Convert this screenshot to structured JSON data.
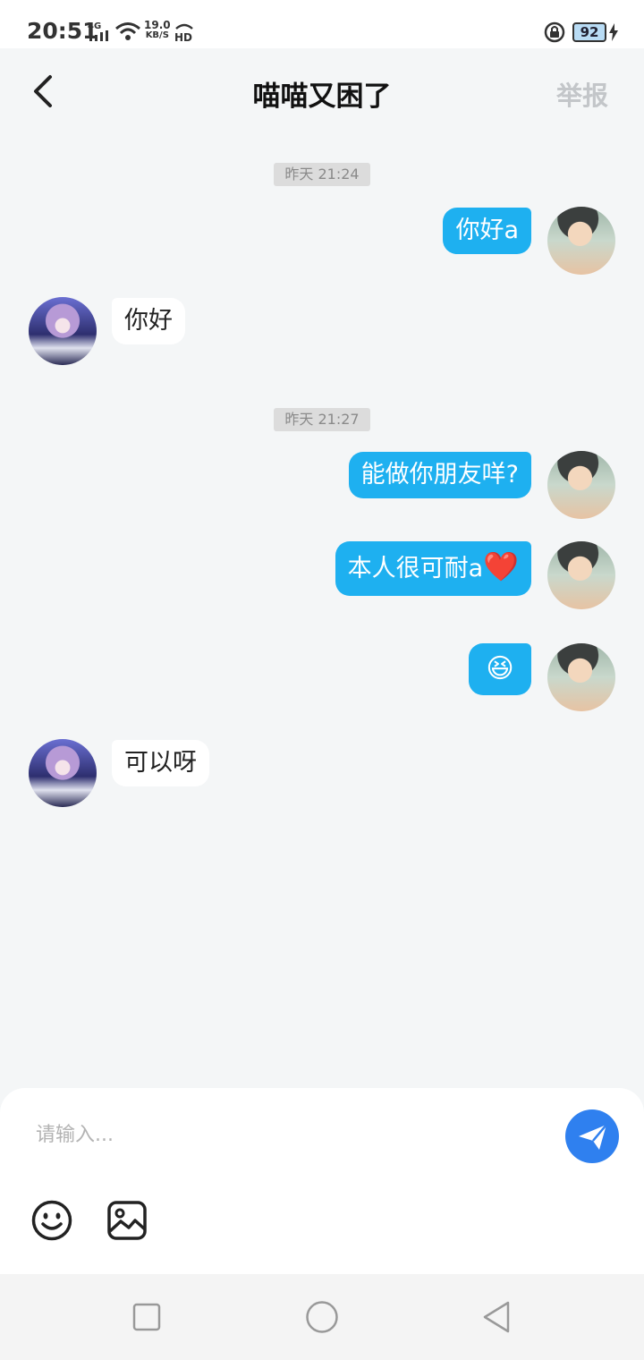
{
  "status_bar": {
    "time": "20:51",
    "network": "4G",
    "speed_value": "19.0",
    "speed_unit": "KB/S",
    "hd": "HD",
    "battery": "92"
  },
  "header": {
    "title": "喵喵又困了",
    "report": "举报"
  },
  "messages": [
    {
      "type": "timestamp",
      "text": "昨天 21:24"
    },
    {
      "type": "out",
      "text": "你好a"
    },
    {
      "type": "in",
      "text": "你好"
    },
    {
      "type": "timestamp",
      "text": "昨天 21:27"
    },
    {
      "type": "out",
      "text": "能做你朋友咩?"
    },
    {
      "type": "out",
      "text": "本人很可耐a",
      "emoji": "❤️"
    },
    {
      "type": "out",
      "emoji": "😆"
    },
    {
      "type": "in",
      "text": "可以呀"
    }
  ],
  "input": {
    "placeholder": "请输入..."
  },
  "colors": {
    "out_bubble": "#1eb0f0",
    "send_button": "#2f80ef"
  },
  "icons": [
    "back-arrow-icon",
    "send-icon",
    "emoji-icon",
    "image-icon",
    "recents-icon",
    "home-icon",
    "back-icon"
  ]
}
